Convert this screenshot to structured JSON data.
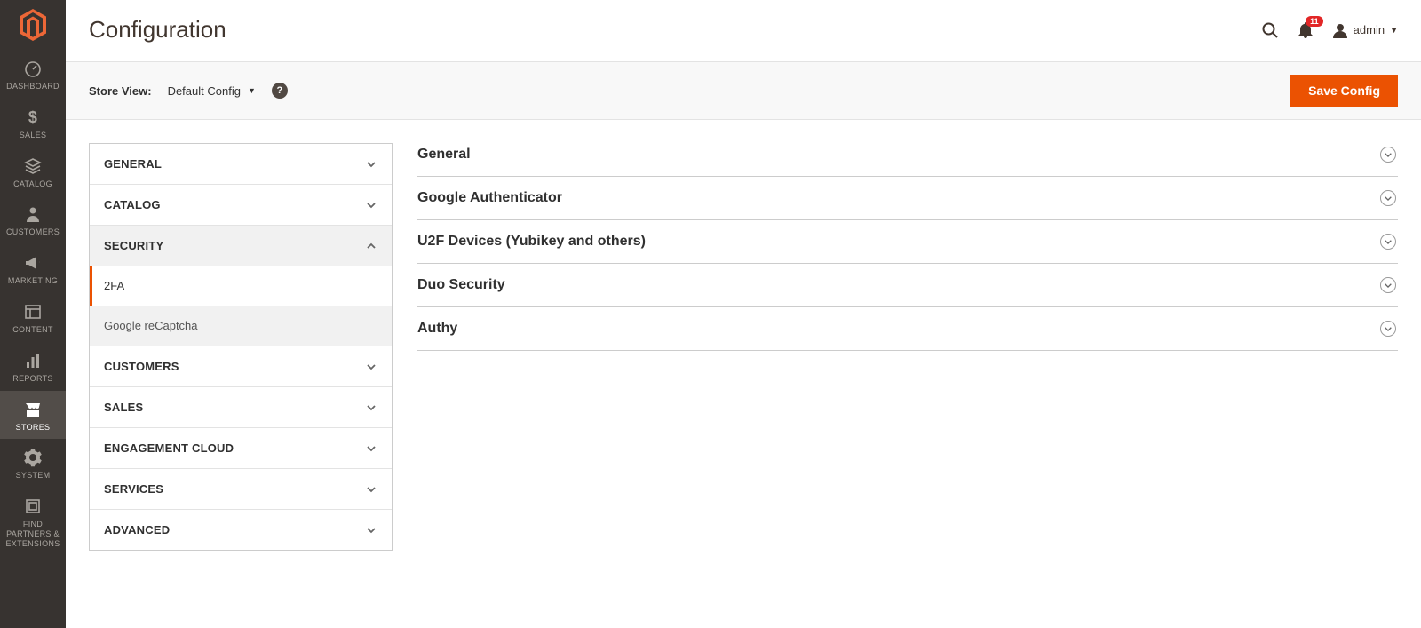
{
  "brand": "Magento",
  "notification_count": "11",
  "admin_user": "admin",
  "page_title": "Configuration",
  "store_view_label": "Store View:",
  "store_view_value": "Default Config",
  "save_button_label": "Save Config",
  "leftnav": [
    {
      "key": "dashboard",
      "label": "DASHBOARD"
    },
    {
      "key": "sales",
      "label": "SALES"
    },
    {
      "key": "catalog",
      "label": "CATALOG"
    },
    {
      "key": "customers",
      "label": "CUSTOMERS"
    },
    {
      "key": "marketing",
      "label": "MARKETING"
    },
    {
      "key": "content",
      "label": "CONTENT"
    },
    {
      "key": "reports",
      "label": "REPORTS"
    },
    {
      "key": "stores",
      "label": "STORES"
    },
    {
      "key": "system",
      "label": "SYSTEM"
    },
    {
      "key": "partners",
      "label": "FIND PARTNERS & EXTENSIONS"
    }
  ],
  "leftnav_active": "stores",
  "config_nav": [
    {
      "key": "general",
      "label": "GENERAL",
      "expanded": false
    },
    {
      "key": "catalog",
      "label": "CATALOG",
      "expanded": false
    },
    {
      "key": "security",
      "label": "SECURITY",
      "expanded": true,
      "items": [
        {
          "key": "2fa",
          "label": "2FA",
          "active": true
        },
        {
          "key": "recaptcha",
          "label": "Google reCaptcha",
          "active": false
        }
      ]
    },
    {
      "key": "customers",
      "label": "CUSTOMERS",
      "expanded": false
    },
    {
      "key": "sales",
      "label": "SALES",
      "expanded": false
    },
    {
      "key": "engagement",
      "label": "ENGAGEMENT CLOUD",
      "expanded": false
    },
    {
      "key": "services",
      "label": "SERVICES",
      "expanded": false
    },
    {
      "key": "advanced",
      "label": "ADVANCED",
      "expanded": false
    }
  ],
  "config_panels": [
    {
      "key": "general",
      "label": "General"
    },
    {
      "key": "google_auth",
      "label": "Google Authenticator"
    },
    {
      "key": "u2f",
      "label": "U2F Devices (Yubikey and others)"
    },
    {
      "key": "duo",
      "label": "Duo Security"
    },
    {
      "key": "authy",
      "label": "Authy"
    }
  ]
}
